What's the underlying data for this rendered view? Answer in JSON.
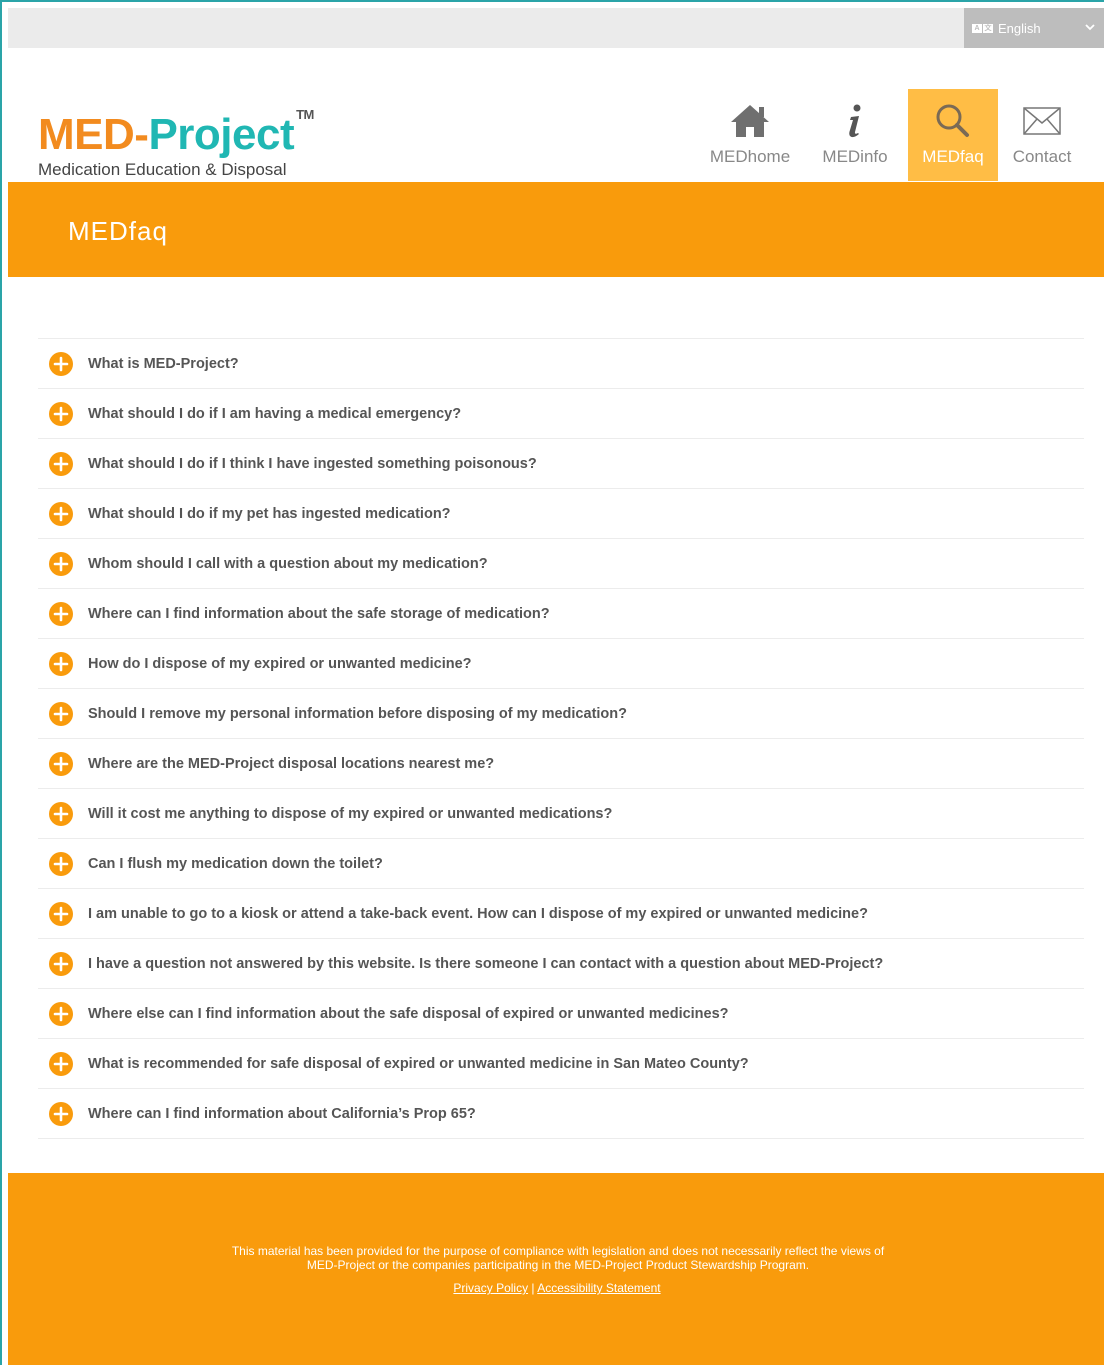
{
  "language": {
    "label": "English",
    "icon": "language-icon",
    "chevron": "chevron-down-icon"
  },
  "logo": {
    "part1": "MED-",
    "part2": "Project",
    "trademark": "TM",
    "subtitle": "Medication Education & Disposal",
    "colors": {
      "orange": "#f28b1f",
      "teal": "#20b7b3"
    }
  },
  "nav": {
    "items": [
      {
        "label": "MEDhome",
        "icon": "home-icon"
      },
      {
        "label": "MEDinfo",
        "icon": "info-icon"
      },
      {
        "label": "MEDfaq",
        "icon": "search-icon",
        "active": true
      },
      {
        "label": "Contact",
        "icon": "envelope-icon"
      }
    ],
    "active_color": "#ffbd45"
  },
  "banner": {
    "title": "MEDfaq",
    "color": "#f99b0c"
  },
  "faq": {
    "icon": "plus-circle-icon",
    "icon_color": "#f99b0c",
    "questions": [
      "What is MED-Project?",
      "What should I do if I am having a medical emergency?",
      "What should I do if I think I have ingested something poisonous?",
      "What should I do if my pet has ingested medication?",
      "Whom should I call with a question about my medication?",
      "Where can I find information about the safe storage of medication?",
      "How do I dispose of my expired or unwanted medicine?",
      "Should I remove my personal information before disposing of my medication?",
      "Where are the MED-Project disposal locations nearest me?",
      "Will it cost me anything to dispose of my expired or unwanted medications?",
      "Can I flush my medication down the toilet?",
      "I am unable to go to a kiosk or attend a take-back event. How can I dispose of my expired or unwanted medicine?",
      "I have a question not answered by this website. Is there someone I can contact with a question about MED-Project?",
      "Where else can I find information about the safe disposal of expired or unwanted medicines?",
      "What is recommended for safe disposal of expired or unwanted medicine in San Mateo County?",
      "Where can I find information about California’s Prop 65?"
    ]
  },
  "footer": {
    "line1": "This material has been provided for the purpose of compliance with legislation and does not necessarily reflect the views of",
    "line2": "MED-Project or the companies participating in the MED-Project Product Stewardship Program.",
    "privacy_link": "Privacy Policy",
    "separator": "|",
    "accessibility_link": "Accessibility Statement"
  }
}
